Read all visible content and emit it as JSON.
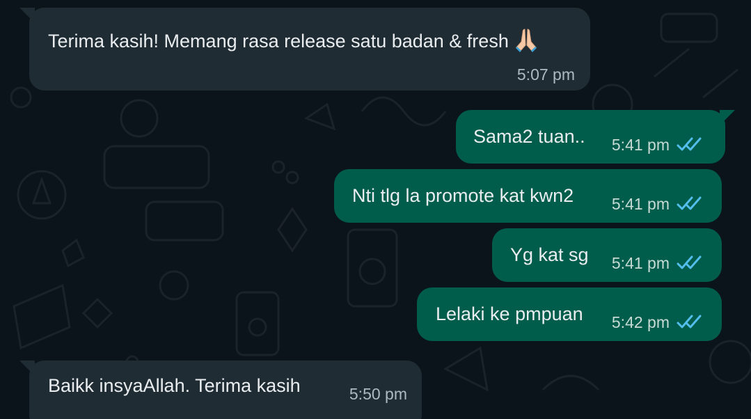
{
  "messages": [
    {
      "direction": "incoming",
      "text": "Terima kasih! Memang rasa release satu badan & fresh",
      "emoji": "folded-hands",
      "time": "5:07 pm"
    },
    {
      "direction": "outgoing",
      "text": "Sama2 tuan..",
      "time": "5:41 pm",
      "status": "read"
    },
    {
      "direction": "outgoing",
      "text": "Nti tlg la promote kat kwn2",
      "time": "5:41 pm",
      "status": "read"
    },
    {
      "direction": "outgoing",
      "text": "Yg kat sg",
      "time": "5:41 pm",
      "status": "read"
    },
    {
      "direction": "outgoing",
      "text": "Lelaki ke pmpuan",
      "time": "5:42 pm",
      "status": "read"
    },
    {
      "direction": "incoming",
      "text": "Baikk insyaAllah. Terima kasih",
      "time": "5:50 pm"
    }
  ],
  "colors": {
    "background": "#0b141a",
    "incoming_bubble": "#202c33",
    "outgoing_bubble": "#005c4b",
    "read_ticks": "#53bdeb"
  }
}
